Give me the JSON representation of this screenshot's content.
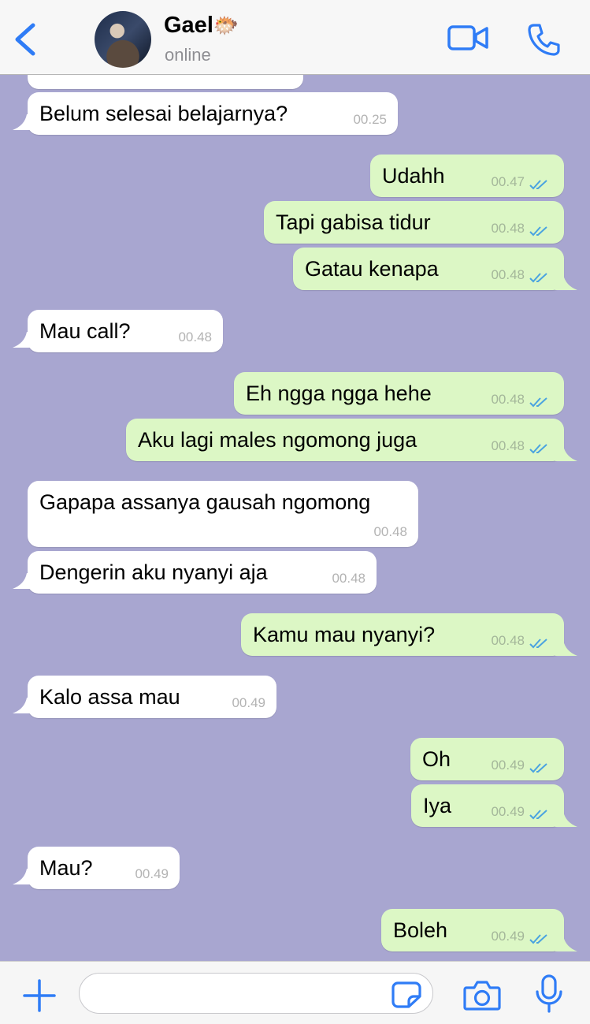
{
  "header": {
    "contact_name": "Gael",
    "name_emoji": "🐡",
    "status": "online",
    "icons": [
      "chevron-left-icon",
      "video-camera-icon",
      "phone-icon"
    ],
    "accent_color": "#2f7cf6"
  },
  "chat": {
    "background_color": "#a8a6d0",
    "incoming_bubble_color": "#ffffff",
    "outgoing_bubble_color": "#dcf7c5",
    "read_tick_color": "#4aa3e0",
    "messages": [
      {
        "dir": "in",
        "text": "Belum selesai belajarnya?",
        "time": "00.25"
      },
      {
        "dir": "out",
        "text": "Udahh",
        "time": "00.47"
      },
      {
        "dir": "out",
        "text": "Tapi gabisa tidur",
        "time": "00.48"
      },
      {
        "dir": "out",
        "text": "Gatau kenapa",
        "time": "00.48"
      },
      {
        "dir": "in",
        "text": "Mau call?",
        "time": "00.48"
      },
      {
        "dir": "out",
        "text": "Eh ngga ngga hehe",
        "time": "00.48"
      },
      {
        "dir": "out",
        "text": "Aku lagi males ngomong juga",
        "time": "00.48"
      },
      {
        "dir": "in",
        "text": "Gapapa assanya gausah ngomong",
        "time": "00.48"
      },
      {
        "dir": "in",
        "text": "Dengerin aku nyanyi aja",
        "time": "00.48"
      },
      {
        "dir": "out",
        "text": "Kamu mau nyanyi?",
        "time": "00.48"
      },
      {
        "dir": "in",
        "text": "Kalo assa mau",
        "time": "00.49"
      },
      {
        "dir": "out",
        "text": "Oh",
        "time": "00.49"
      },
      {
        "dir": "out",
        "text": "Iya",
        "time": "00.49"
      },
      {
        "dir": "in",
        "text": "Mau?",
        "time": "00.49"
      },
      {
        "dir": "out",
        "text": "Boleh",
        "time": "00.49"
      }
    ]
  },
  "input_bar": {
    "message_value": "",
    "icons": [
      "plus-icon",
      "sticker-icon",
      "camera-icon",
      "microphone-icon"
    ]
  }
}
